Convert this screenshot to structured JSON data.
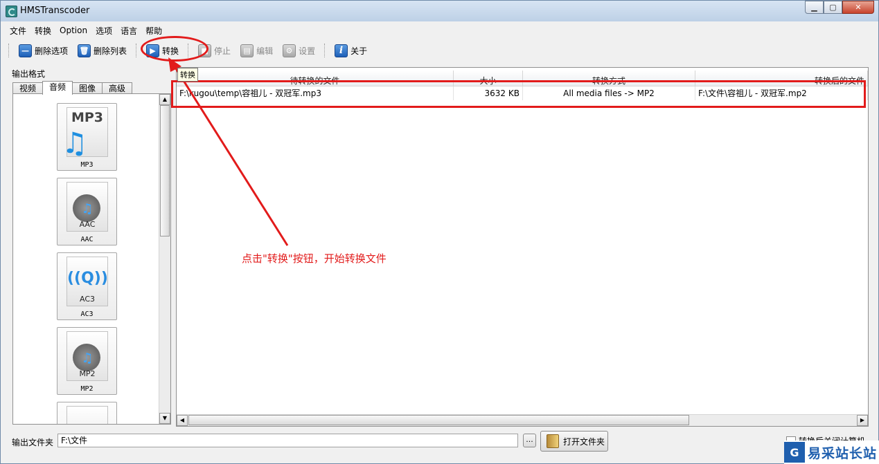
{
  "window": {
    "title": "HMSTranscoder"
  },
  "menu": [
    "文件",
    "转换",
    "Option",
    "选项",
    "语言",
    "帮助"
  ],
  "toolbar": {
    "delete_item": "删除选项",
    "delete_list": "删除列表",
    "convert": "转换",
    "stop": "停止",
    "edit": "编辑",
    "settings": "设置",
    "about": "关于"
  },
  "left": {
    "output_format_label": "输出格式",
    "tabs": [
      "视频",
      "音频",
      "图像",
      "高级"
    ],
    "active_tab": "音频",
    "formats": [
      {
        "icon_text": "MP3",
        "caption": "MP3"
      },
      {
        "icon_text": "AAC",
        "caption": "AAC"
      },
      {
        "icon_text": "AC3",
        "caption": "AC3"
      },
      {
        "icon_text": "MP2",
        "caption": "MP2"
      }
    ]
  },
  "table": {
    "tooltip": "转换",
    "columns": [
      "待转换的文件",
      "大小",
      "转换方式",
      "转换后的文件"
    ],
    "rows": [
      {
        "source": "F:\\kugou\\temp\\容祖儿 - 双冠军.mp3",
        "size": "3632 KB",
        "method": "All media files -> MP2",
        "target": "F:\\文件\\容祖儿 - 双冠军.mp2"
      }
    ]
  },
  "bottom": {
    "output_folder_label": "输出文件夹",
    "output_folder_value": "F:\\文件",
    "browse": "...",
    "open_folder": "打开文件夹",
    "shutdown_label": "转换后关闭计算机"
  },
  "annotation": {
    "text": "点击\"转换\"按钮，开始转换文件",
    "color": "#e21b1b"
  },
  "watermark": {
    "logo": "G",
    "text": "易采站长站"
  }
}
